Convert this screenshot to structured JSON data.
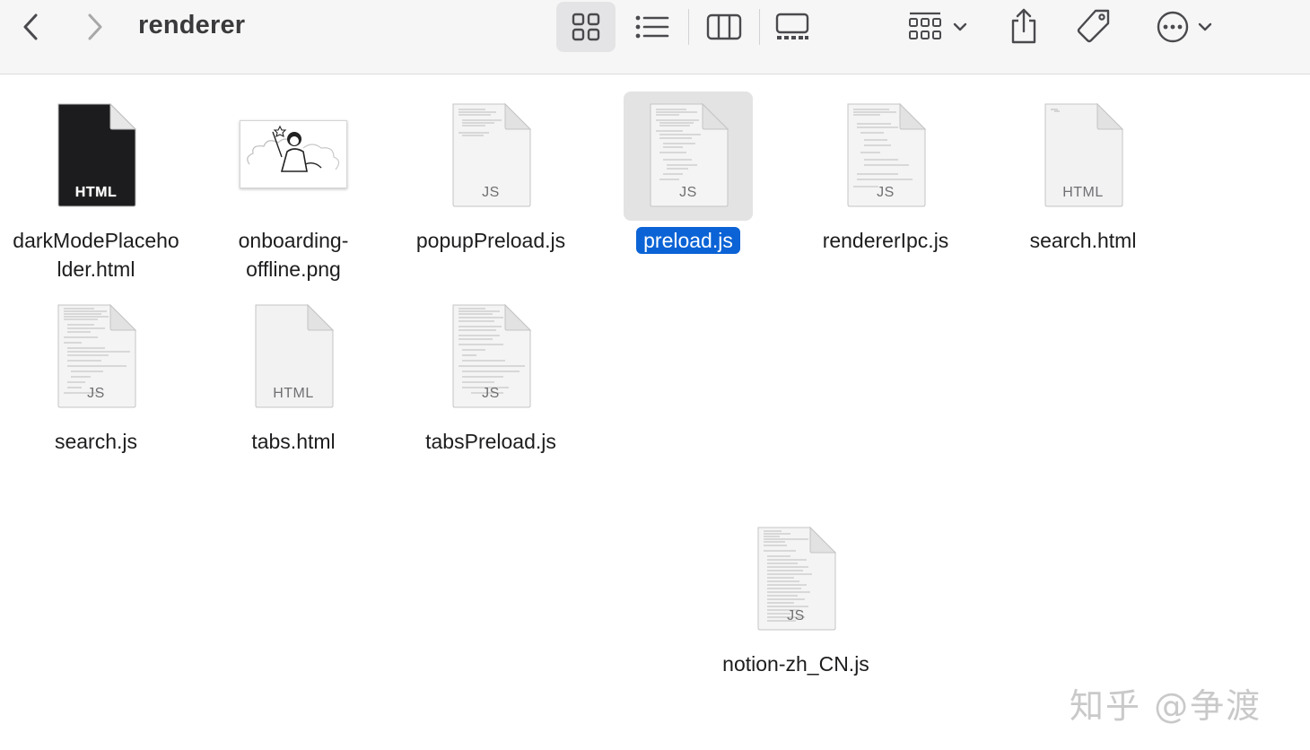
{
  "window": {
    "title": "renderer"
  },
  "toolbar": {
    "back_icon": "chevron-left-icon",
    "forward_icon": "chevron-right-icon",
    "views": [
      "icon-view-icon",
      "list-view-icon",
      "column-view-icon",
      "gallery-view-icon"
    ],
    "active_view": "icon-view-icon",
    "group_icon": "group-grid-icon",
    "share_icon": "share-icon",
    "tag_icon": "tag-icon",
    "more_icon": "ellipsis-circle-icon"
  },
  "files": [
    {
      "name": "darkModePlacehoIder.html",
      "line1": "darkModePlaceho",
      "line2": "lder.html",
      "ext": "HTML",
      "kind": "dark-html"
    },
    {
      "name": "onboarding-offline.png",
      "line1": "onboarding-",
      "line2": "offline.png",
      "ext": "",
      "kind": "png"
    },
    {
      "name": "popupPreload.js",
      "line1": "popupPreload.js",
      "line2": "",
      "ext": "JS",
      "kind": "js"
    },
    {
      "name": "preload.js",
      "line1": "preload.js",
      "line2": "",
      "ext": "JS",
      "kind": "js",
      "selected": true
    },
    {
      "name": "rendererIpc.js",
      "line1": "rendererIpc.js",
      "line2": "",
      "ext": "JS",
      "kind": "js"
    },
    {
      "name": "search.html",
      "line1": "search.html",
      "line2": "",
      "ext": "HTML",
      "kind": "html"
    },
    {
      "name": "search.js",
      "line1": "search.js",
      "line2": "",
      "ext": "JS",
      "kind": "js"
    },
    {
      "name": "tabs.html",
      "line1": "tabs.html",
      "line2": "",
      "ext": "HTML",
      "kind": "html"
    },
    {
      "name": "tabsPreload.js",
      "line1": "tabsPreload.js",
      "line2": "",
      "ext": "JS",
      "kind": "js"
    },
    {
      "name": "notion-zh_CN.js",
      "line1": "notion-zh_CN.js",
      "line2": "",
      "ext": "JS",
      "kind": "js"
    }
  ],
  "colors": {
    "selection": "#0b63d6",
    "toolbar_bg": "#f6f6f6"
  },
  "watermark": "知乎 @争渡"
}
